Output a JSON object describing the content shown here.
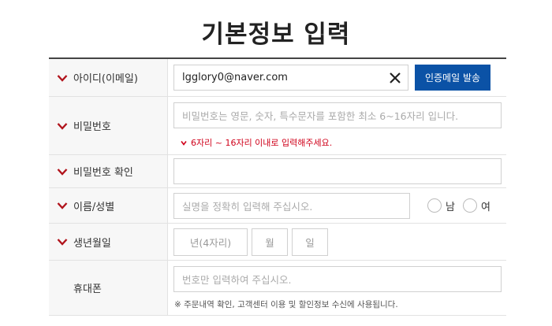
{
  "page": {
    "title": "기본정보 입력"
  },
  "colors": {
    "accent": "#0b52a6",
    "required_mark": "#b1141c",
    "error_text": "#d0021b"
  },
  "fields": {
    "user_id": {
      "label": "아이디(이메일)",
      "value": "lgglory0@naver.com",
      "clear_icon": "close-icon",
      "button_label": "인증메일 발송"
    },
    "password": {
      "label": "비밀번호",
      "placeholder": "비밀번호는 영문, 숫자, 특수문자를 포함한 최소 6~16자리 입니다.",
      "error": "6자리 ~ 16자리 이내로 입력해주세요."
    },
    "password_confirm": {
      "label": "비밀번호 확인",
      "value": ""
    },
    "name_gender": {
      "label": "이름/성별",
      "placeholder": "실명을 정확히 입력해 주십시오.",
      "gender_options": [
        "남",
        "여"
      ]
    },
    "birth": {
      "label": "생년월일",
      "year_placeholder": "년(4자리)",
      "month_placeholder": "월",
      "day_placeholder": "일"
    },
    "phone": {
      "label": "휴대폰",
      "placeholder": "번호만 입력하여 주십시오.",
      "note": "※ 주문내역 확인, 고객센터 이용 및 할인정보 수신에 사용됩니다."
    }
  }
}
